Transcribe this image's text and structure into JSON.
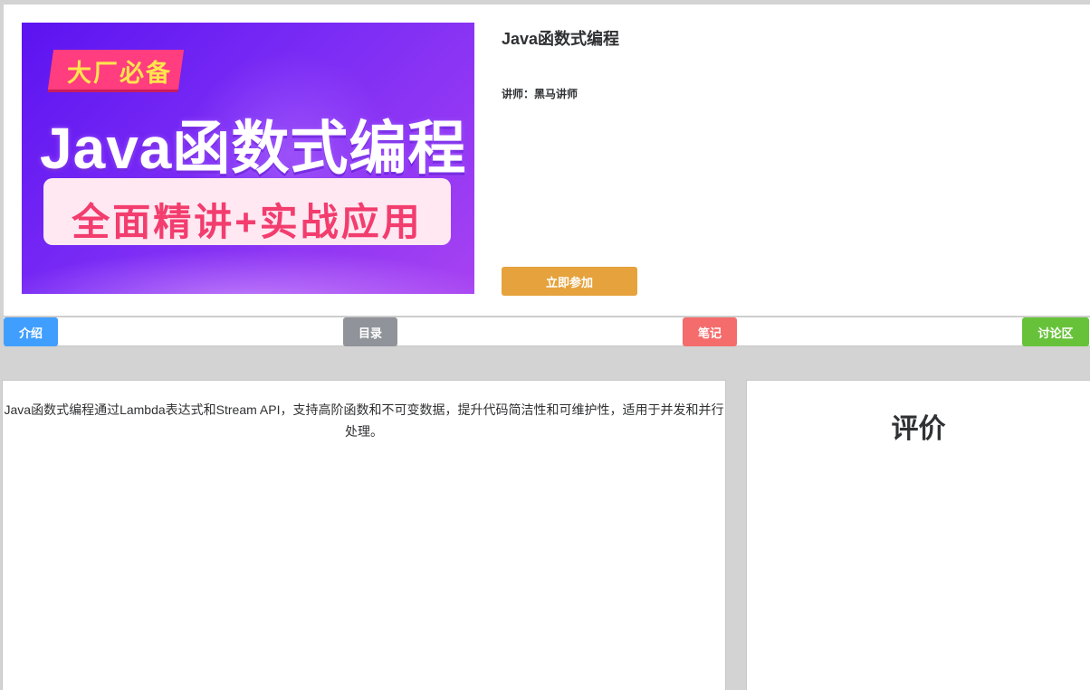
{
  "course": {
    "title": "Java函数式编程",
    "teacher": "讲师：黑马讲师",
    "join_label": "立即参加",
    "cover": {
      "badge": "大厂必备",
      "title": "Java函数式编程",
      "banner": "全面精讲+实战应用"
    }
  },
  "tabs": [
    {
      "label": "介绍",
      "color": "#409eff"
    },
    {
      "label": "目录",
      "color": "#909399"
    },
    {
      "label": "笔记",
      "color": "#f56c6c"
    },
    {
      "label": "讨论区",
      "color": "#67c23a"
    }
  ],
  "intro": {
    "text": "Java函数式编程通过Lambda表达式和Stream API，支持高阶函数和不可变数据，提升代码简洁性和可维护性，适用于并发和并行处理。"
  },
  "review": {
    "title": "评价"
  },
  "colors": {
    "join_button": "#e6a23c",
    "page_background": "#d3d3d3"
  }
}
